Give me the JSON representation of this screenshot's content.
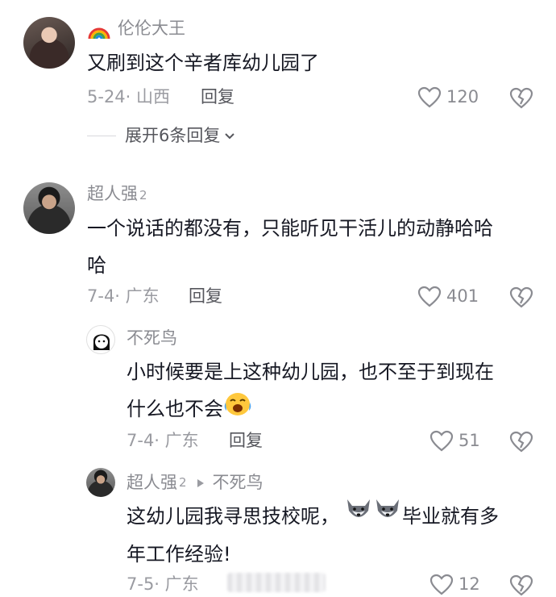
{
  "comments": [
    {
      "username": "伦伦大王",
      "text": "又刷到这个辛者库幼儿园了",
      "meta": "5-24· 山西",
      "reply_label": "回复",
      "likes": "120",
      "expand_label": "展开6条回复"
    },
    {
      "username": "超人强",
      "username_suffix": "2",
      "text_line1": "一个说话的都没有，只能听见干活儿的动静哈哈",
      "text_line2": "哈",
      "meta": "7-4· 广东",
      "reply_label": "回复",
      "likes": "401"
    }
  ],
  "replies": [
    {
      "username": "不死鸟",
      "text_line1": "小时候要是上这种幼儿园，也不至于到现在",
      "text_line2": "什么也不会",
      "meta": "7-4· 广东",
      "reply_label": "回复",
      "likes": "51"
    },
    {
      "username": "超人强",
      "username_suffix": "2",
      "reply_to": "不死鸟",
      "text_part1": "这幼儿园我寻思技校呢，",
      "text_part2": "毕业就有多",
      "text_line2": "年工作经验!",
      "meta": "7-5· 广东",
      "likes": "12"
    }
  ],
  "icons": {
    "rainbow": "rainbow-icon",
    "heart": "heart-outline-icon",
    "dislike": "broken-heart-icon",
    "emoji_cry": "laugh-cry-emoji",
    "wolf": "wolf-emoji"
  },
  "colors": {
    "text_primary": "#161823",
    "text_secondary": "#8a8b91",
    "background": "#ffffff"
  }
}
